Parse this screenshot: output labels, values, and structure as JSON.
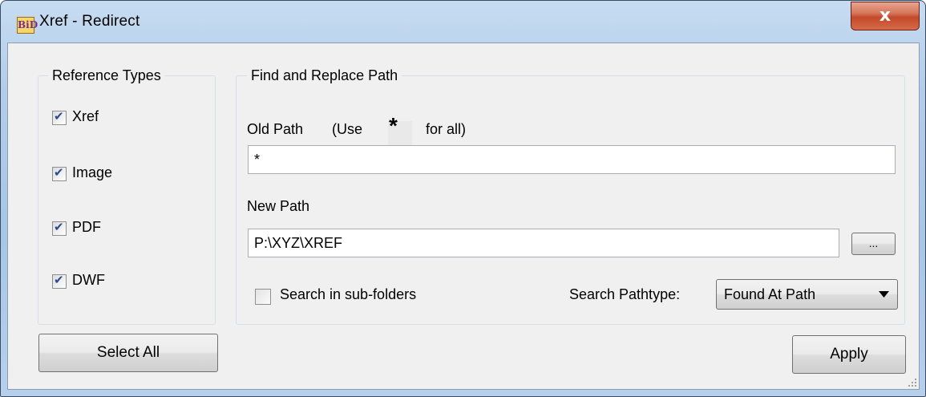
{
  "window": {
    "title": "Xref - Redirect",
    "app_icon_text": "BiD",
    "close_glyph": "x"
  },
  "reference_types": {
    "legend": "Reference Types",
    "items": [
      {
        "label": "Xref",
        "checked": true
      },
      {
        "label": "Image",
        "checked": true
      },
      {
        "label": "PDF",
        "checked": true
      },
      {
        "label": "DWF",
        "checked": true
      }
    ]
  },
  "find_replace": {
    "legend": "Find and Replace Path",
    "old_path_label": "Old Path",
    "old_path_hint_prefix": "(Use",
    "old_path_hint_star": "*",
    "old_path_hint_suffix": "for all)",
    "old_path_value": "*",
    "new_path_label": "New Path",
    "new_path_value": "P:\\XYZ\\XREF",
    "browse_label": "...",
    "search_subfolders_label": "Search in sub-folders",
    "search_subfolders_checked": false,
    "pathtype_label": "Search Pathtype:",
    "pathtype_value": "Found At Path"
  },
  "buttons": {
    "select_all": "Select All",
    "apply": "Apply"
  }
}
